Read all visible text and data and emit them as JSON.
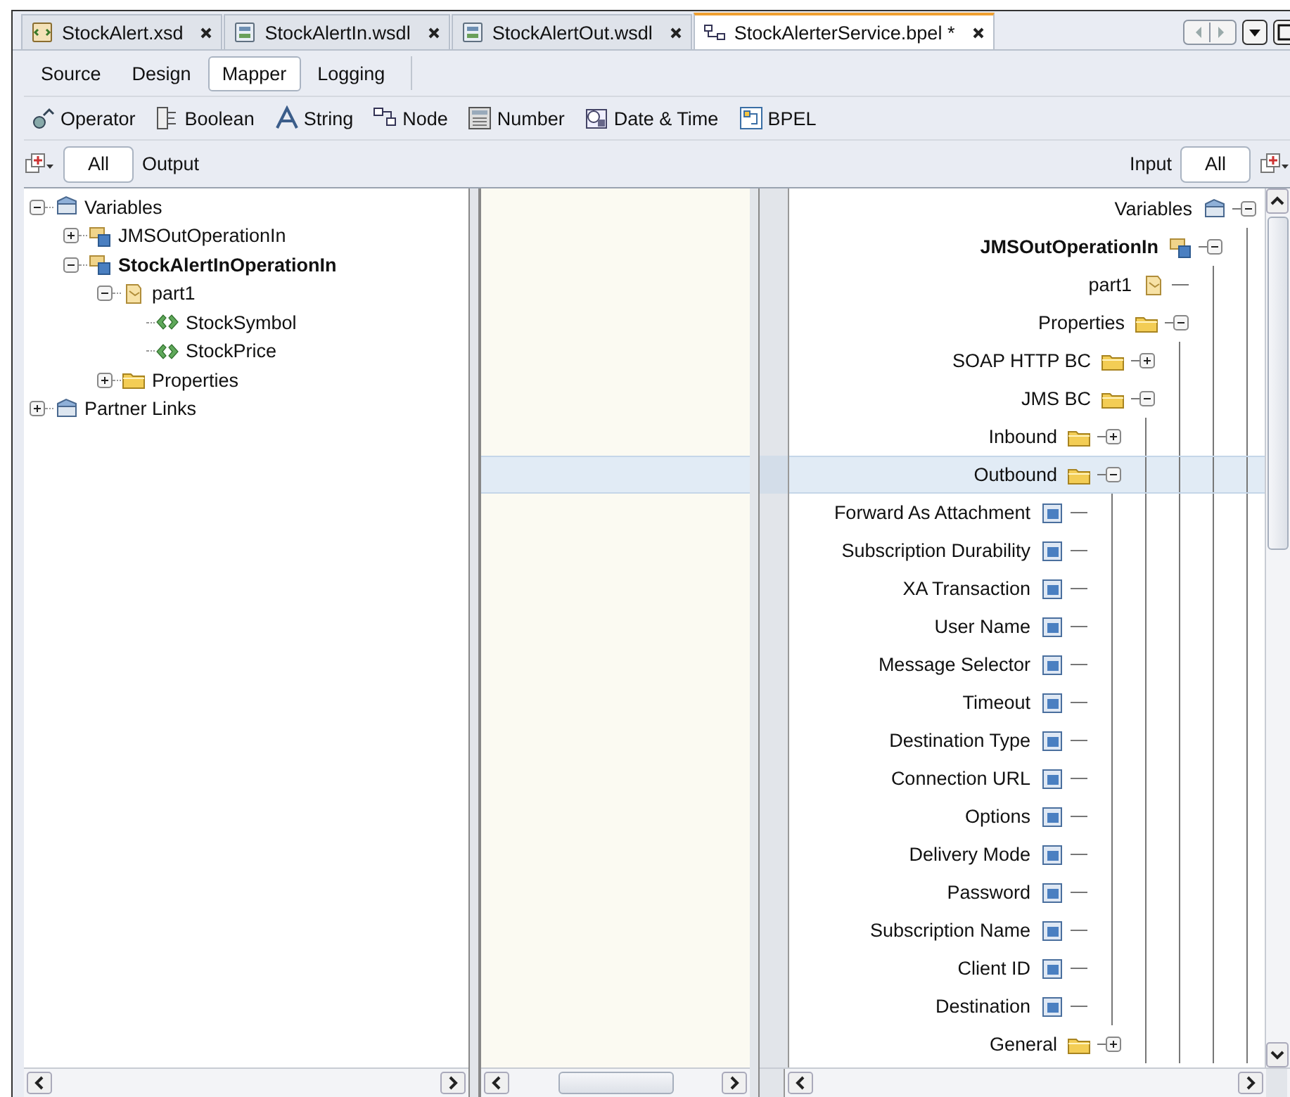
{
  "editor_tabs": [
    {
      "label": "StockAlert.xsd",
      "kind": "xsd",
      "selected": false
    },
    {
      "label": "StockAlertIn.wsdl",
      "kind": "wsdl",
      "selected": false
    },
    {
      "label": "StockAlertOut.wsdl",
      "kind": "wsdl",
      "selected": false
    },
    {
      "label": "StockAlerterService.bpel *",
      "kind": "bpel",
      "selected": true
    }
  ],
  "view_tabs": [
    {
      "label": "Source",
      "selected": false
    },
    {
      "label": "Design",
      "selected": false
    },
    {
      "label": "Mapper",
      "selected": true
    },
    {
      "label": "Logging",
      "selected": false
    }
  ],
  "palette": [
    {
      "label": "Operator",
      "kind": "operator"
    },
    {
      "label": "Boolean",
      "kind": "boolean"
    },
    {
      "label": "String",
      "kind": "string"
    },
    {
      "label": "Node",
      "kind": "node"
    },
    {
      "label": "Number",
      "kind": "number"
    },
    {
      "label": "Date & Time",
      "kind": "datetime"
    },
    {
      "label": "BPEL",
      "kind": "bpel"
    }
  ],
  "output_bar": {
    "filter": "All",
    "label": "Output"
  },
  "input_bar": {
    "label": "Input",
    "filter": "All"
  },
  "output_tree": [
    {
      "label": "Variables",
      "kind": "variables",
      "expanded": true,
      "children": [
        {
          "label": "JMSOutOperationIn",
          "kind": "message",
          "expanded": false
        },
        {
          "label": "StockAlertInOperationIn",
          "kind": "message",
          "bold": true,
          "expanded": true,
          "children": [
            {
              "label": "part1",
              "kind": "part",
              "expanded": true,
              "children": [
                {
                  "label": "StockSymbol",
                  "kind": "element"
                },
                {
                  "label": "StockPrice",
                  "kind": "element"
                }
              ]
            },
            {
              "label": "Properties",
              "kind": "folder",
              "expanded": false
            }
          ]
        }
      ]
    },
    {
      "label": "Partner Links",
      "kind": "variables",
      "expanded": false
    }
  ],
  "input_tree": [
    {
      "label": "Variables",
      "kind": "variables",
      "expanded": true,
      "selected": false,
      "children": [
        {
          "label": "JMSOutOperationIn",
          "kind": "message",
          "bold": true,
          "expanded": true,
          "selected": false,
          "children": [
            {
              "label": "part1",
              "kind": "part",
              "selected": false
            },
            {
              "label": "Properties",
              "kind": "folder",
              "expanded": true,
              "selected": false,
              "children": [
                {
                  "label": "SOAP HTTP BC",
                  "kind": "folder",
                  "expanded": false,
                  "selected": false
                },
                {
                  "label": "JMS BC",
                  "kind": "folder",
                  "expanded": true,
                  "selected": false,
                  "children": [
                    {
                      "label": "Inbound",
                      "kind": "folder",
                      "expanded": false,
                      "selected": false
                    },
                    {
                      "label": "Outbound",
                      "kind": "folder",
                      "expanded": true,
                      "selected": true,
                      "children": [
                        {
                          "label": "Forward As Attachment",
                          "kind": "property",
                          "selected": false
                        },
                        {
                          "label": "Subscription Durability",
                          "kind": "property",
                          "selected": false
                        },
                        {
                          "label": "XA Transaction",
                          "kind": "property",
                          "selected": false
                        },
                        {
                          "label": "User Name",
                          "kind": "property",
                          "selected": false
                        },
                        {
                          "label": "Message Selector",
                          "kind": "property",
                          "selected": false
                        },
                        {
                          "label": "Timeout",
                          "kind": "property",
                          "selected": false
                        },
                        {
                          "label": "Destination Type",
                          "kind": "property",
                          "selected": false
                        },
                        {
                          "label": "Connection URL",
                          "kind": "property",
                          "selected": false
                        },
                        {
                          "label": "Options",
                          "kind": "property",
                          "selected": false
                        },
                        {
                          "label": "Delivery Mode",
                          "kind": "property",
                          "selected": false
                        },
                        {
                          "label": "Password",
                          "kind": "property",
                          "selected": false
                        },
                        {
                          "label": "Subscription Name",
                          "kind": "property",
                          "selected": false
                        },
                        {
                          "label": "Client ID",
                          "kind": "property",
                          "selected": false
                        },
                        {
                          "label": "Destination",
                          "kind": "property",
                          "selected": false
                        }
                      ]
                    },
                    {
                      "label": "General",
                      "kind": "folder",
                      "expanded": false,
                      "selected": false
                    }
                  ]
                }
              ]
            }
          ]
        }
      ]
    }
  ]
}
